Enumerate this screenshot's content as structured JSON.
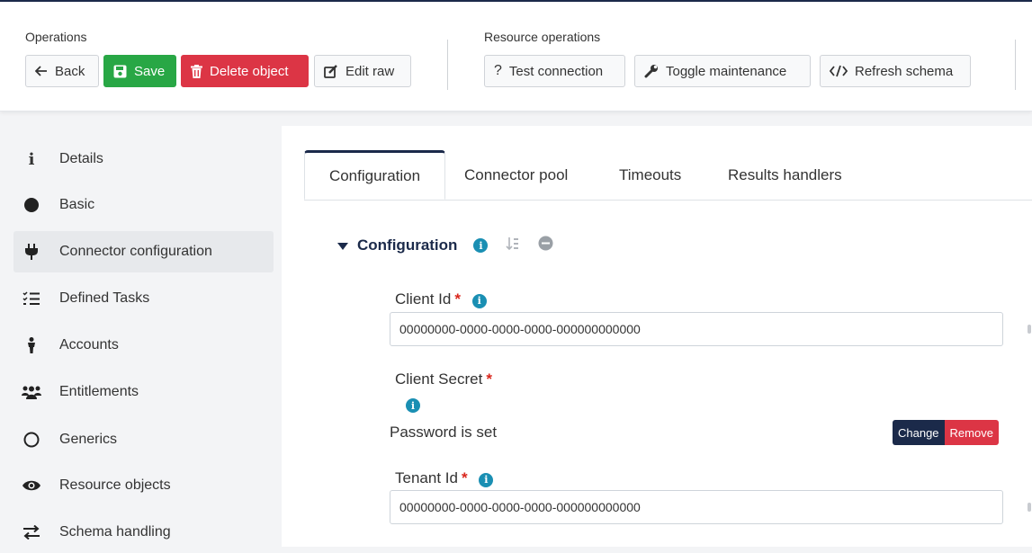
{
  "toolbar": {
    "operations_label": "Operations",
    "back_label": "Back",
    "save_label": "Save",
    "delete_label": "Delete object",
    "edit_raw_label": "Edit raw",
    "resource_operations_label": "Resource operations",
    "test_connection_label": "Test connection",
    "toggle_maintenance_label": "Toggle maintenance",
    "refresh_schema_label": "Refresh schema"
  },
  "sidebar": {
    "items": [
      {
        "label": "Details",
        "icon": "info-icon"
      },
      {
        "label": "Basic",
        "icon": "circle-filled-icon"
      },
      {
        "label": "Connector configuration",
        "icon": "plug-icon",
        "active": true
      },
      {
        "label": "Defined Tasks",
        "icon": "tasks-list-icon"
      },
      {
        "label": "Accounts",
        "icon": "person-icon"
      },
      {
        "label": "Entitlements",
        "icon": "users-icon"
      },
      {
        "label": "Generics",
        "icon": "circle-outline-icon"
      },
      {
        "label": "Resource objects",
        "icon": "eye-icon"
      },
      {
        "label": "Schema handling",
        "icon": "exchange-icon"
      }
    ]
  },
  "tabs": [
    {
      "label": "Configuration",
      "active": true
    },
    {
      "label": "Connector pool"
    },
    {
      "label": "Timeouts"
    },
    {
      "label": "Results handlers"
    }
  ],
  "section": {
    "title": "Configuration"
  },
  "fields": {
    "client_id": {
      "label": "Client Id",
      "value": "00000000-0000-0000-0000-000000000000"
    },
    "client_secret": {
      "label": "Client Secret",
      "status": "Password is set",
      "change_label": "Change",
      "remove_label": "Remove"
    },
    "tenant_id": {
      "label": "Tenant Id",
      "value": "00000000-0000-0000-0000-000000000000"
    }
  },
  "colors": {
    "accent": "#1b2a4a",
    "save": "#28a745",
    "delete": "#dc3545",
    "info": "#1a8fb3"
  }
}
